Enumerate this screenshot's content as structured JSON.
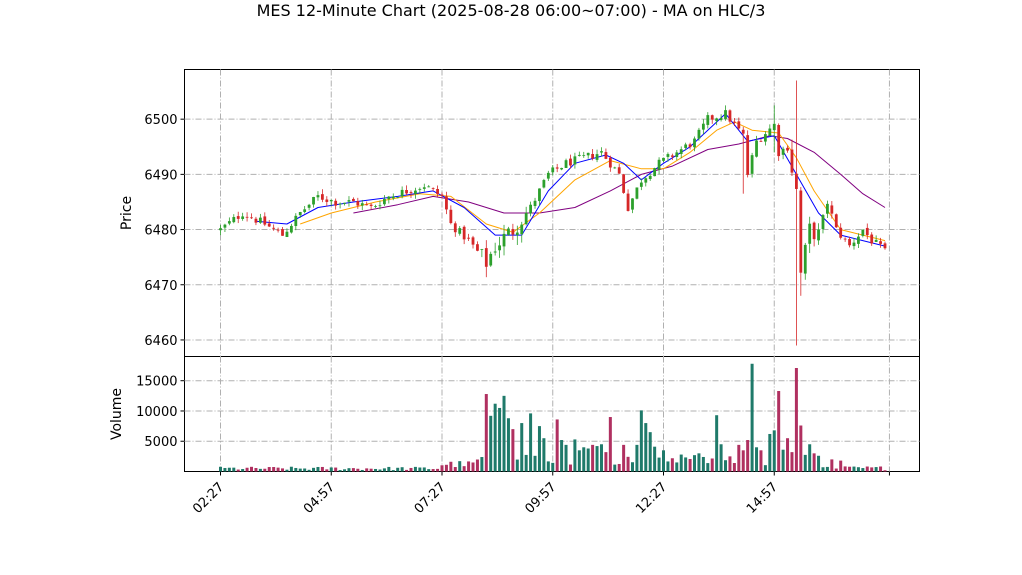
{
  "chart_data": {
    "type": "candlestick",
    "title": "MES 12-Minute Chart (2025-08-28 06:00~07:00) - MA on HLC/3",
    "price_panel": {
      "ylabel": "Price",
      "ylim": [
        6457,
        6509
      ],
      "yticks": [
        6460,
        6470,
        6480,
        6490,
        6500
      ],
      "grid": true
    },
    "volume_panel": {
      "ylabel": "Volume",
      "ylim": [
        0,
        19000
      ],
      "yticks": [
        5000,
        10000,
        15000
      ],
      "grid": true
    },
    "x_tick_labels": [
      "02:27",
      "04:57",
      "07:27",
      "09:57",
      "12:27",
      "14:57"
    ],
    "x_tick_index": [
      0,
      25,
      50,
      75,
      100,
      125
    ],
    "num_bars": 151,
    "colors": {
      "up": "#2ca02c",
      "down": "#d62728",
      "ma_fast": "#0000ff",
      "ma_mid": "#ffa500",
      "ma_slow": "#800080",
      "vol_up": "#1f7a6a",
      "vol_down": "#b03060"
    },
    "price_anchors": [
      [
        0,
        6480
      ],
      [
        5,
        6483
      ],
      [
        10,
        6481
      ],
      [
        14,
        6479
      ],
      [
        18,
        6483
      ],
      [
        22,
        6486
      ],
      [
        26,
        6485
      ],
      [
        30,
        6485
      ],
      [
        34,
        6484
      ],
      [
        38,
        6486
      ],
      [
        42,
        6487
      ],
      [
        46,
        6488
      ],
      [
        50,
        6486
      ],
      [
        52,
        6481
      ],
      [
        56,
        6478
      ],
      [
        60,
        6474
      ],
      [
        62,
        6477
      ],
      [
        66,
        6480
      ],
      [
        70,
        6484
      ],
      [
        74,
        6490
      ],
      [
        78,
        6492
      ],
      [
        82,
        6493
      ],
      [
        86,
        6494
      ],
      [
        90,
        6490
      ],
      [
        92,
        6484
      ],
      [
        95,
        6489
      ],
      [
        99,
        6492
      ],
      [
        103,
        6494
      ],
      [
        107,
        6496
      ],
      [
        110,
        6500
      ],
      [
        114,
        6501
      ],
      [
        118,
        6497
      ],
      [
        119,
        6490
      ],
      [
        121,
        6496
      ],
      [
        125,
        6499
      ],
      [
        126,
        6494
      ],
      [
        128,
        6495
      ],
      [
        130,
        6487
      ],
      [
        131,
        6472
      ],
      [
        133,
        6480
      ],
      [
        135,
        6479
      ],
      [
        137,
        6485
      ],
      [
        139,
        6480
      ],
      [
        142,
        6477
      ],
      [
        145,
        6480
      ],
      [
        147,
        6478
      ],
      [
        150,
        6476
      ]
    ],
    "ma_fast": [
      [
        8,
        6481.5
      ],
      [
        15,
        6481
      ],
      [
        22,
        6484
      ],
      [
        30,
        6485
      ],
      [
        40,
        6486
      ],
      [
        48,
        6487
      ],
      [
        55,
        6484
      ],
      [
        62,
        6479
      ],
      [
        68,
        6479
      ],
      [
        74,
        6487
      ],
      [
        80,
        6492
      ],
      [
        87,
        6493.5
      ],
      [
        91,
        6492
      ],
      [
        95,
        6489
      ],
      [
        100,
        6492
      ],
      [
        106,
        6495
      ],
      [
        114,
        6501
      ],
      [
        119,
        6496
      ],
      [
        125,
        6497
      ],
      [
        130,
        6490
      ],
      [
        135,
        6483
      ],
      [
        140,
        6479
      ],
      [
        145,
        6478
      ],
      [
        150,
        6477
      ]
    ],
    "ma_mid": [
      [
        18,
        6481
      ],
      [
        25,
        6483
      ],
      [
        35,
        6485
      ],
      [
        45,
        6486.5
      ],
      [
        52,
        6486
      ],
      [
        60,
        6481
      ],
      [
        66,
        6479.5
      ],
      [
        72,
        6483
      ],
      [
        80,
        6489
      ],
      [
        88,
        6492.5
      ],
      [
        95,
        6491
      ],
      [
        100,
        6491
      ],
      [
        106,
        6494
      ],
      [
        112,
        6498
      ],
      [
        116,
        6499.5
      ],
      [
        120,
        6498
      ],
      [
        126,
        6497.5
      ],
      [
        130,
        6493
      ],
      [
        134,
        6487
      ],
      [
        140,
        6480
      ],
      [
        145,
        6479
      ],
      [
        150,
        6478
      ]
    ],
    "ma_slow": [
      [
        30,
        6483
      ],
      [
        40,
        6484.5
      ],
      [
        48,
        6486
      ],
      [
        56,
        6485
      ],
      [
        64,
        6483
      ],
      [
        72,
        6483
      ],
      [
        80,
        6484
      ],
      [
        88,
        6487
      ],
      [
        95,
        6490
      ],
      [
        102,
        6491.5
      ],
      [
        110,
        6494.5
      ],
      [
        117,
        6495.5
      ],
      [
        124,
        6497
      ],
      [
        128,
        6496.5
      ],
      [
        134,
        6494
      ],
      [
        140,
        6490
      ],
      [
        145,
        6486.5
      ],
      [
        150,
        6484
      ]
    ],
    "volume_spikes": [
      [
        60,
        12800
      ],
      [
        61,
        9200
      ],
      [
        62,
        11200
      ],
      [
        63,
        10500
      ],
      [
        64,
        12500
      ],
      [
        65,
        8800
      ],
      [
        66,
        7000
      ],
      [
        68,
        8000
      ],
      [
        70,
        9600
      ],
      [
        72,
        7500
      ],
      [
        73,
        5500
      ],
      [
        76,
        8600
      ],
      [
        77,
        5200
      ],
      [
        78,
        4400
      ],
      [
        80,
        5300
      ],
      [
        81,
        3500
      ],
      [
        82,
        4000
      ],
      [
        83,
        3800
      ],
      [
        84,
        4400
      ],
      [
        85,
        4200
      ],
      [
        86,
        4500
      ],
      [
        87,
        3200
      ],
      [
        88,
        9000
      ],
      [
        91,
        4400
      ],
      [
        94,
        4400
      ],
      [
        95,
        10100
      ],
      [
        96,
        8000
      ],
      [
        97,
        6500
      ],
      [
        98,
        4100
      ],
      [
        100,
        3500
      ],
      [
        104,
        2800
      ],
      [
        108,
        3000
      ],
      [
        109,
        2400
      ],
      [
        112,
        9300
      ],
      [
        113,
        4500
      ],
      [
        115,
        2500
      ],
      [
        117,
        4400
      ],
      [
        118,
        3500
      ],
      [
        119,
        5200
      ],
      [
        120,
        17800
      ],
      [
        121,
        4000
      ],
      [
        122,
        3500
      ],
      [
        124,
        6200
      ],
      [
        125,
        6800
      ],
      [
        126,
        13300
      ],
      [
        127,
        3600
      ],
      [
        128,
        5500
      ],
      [
        129,
        3200
      ],
      [
        130,
        17100
      ],
      [
        131,
        7600
      ],
      [
        133,
        4500
      ],
      [
        134,
        3000
      ],
      [
        135,
        2600
      ],
      [
        138,
        2000
      ],
      [
        140,
        1800
      ]
    ],
    "price_wicks_extreme": [
      [
        125,
        6502.5,
        6494
      ],
      [
        130,
        6507,
        6459
      ],
      [
        131,
        6480,
        6468
      ],
      [
        118,
        6495,
        6486.5
      ]
    ]
  }
}
